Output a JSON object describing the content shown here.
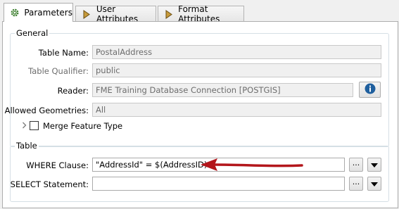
{
  "tabs": [
    {
      "label": "Parameters",
      "icon": "gear-icon"
    },
    {
      "label": "User Attributes",
      "icon": "attribute-arrow-icon"
    },
    {
      "label": "Format Attributes",
      "icon": "attribute-arrow-icon"
    }
  ],
  "general": {
    "title": "General",
    "table_name_label": "Table Name:",
    "table_name_value": "PostalAddress",
    "table_qualifier_label": "Table Qualifier:",
    "table_qualifier_value": "public",
    "reader_label": "Reader:",
    "reader_value": "FME Training Database Connection [POSTGIS]",
    "allowed_geometries_label": "Allowed Geometries:",
    "allowed_geometries_value": "All",
    "merge_feature_type_label": "Merge Feature Type",
    "merge_feature_type_checked": false
  },
  "table": {
    "title": "Table",
    "where_label": "WHERE Clause:",
    "where_value": "\"AddressId\" = $(AddressID)",
    "select_label": "SELECT Statement:",
    "select_value": "",
    "ellipsis_label": "..."
  },
  "colors": {
    "arrow": "#b3161b",
    "info_button": "#1f5f9e"
  }
}
